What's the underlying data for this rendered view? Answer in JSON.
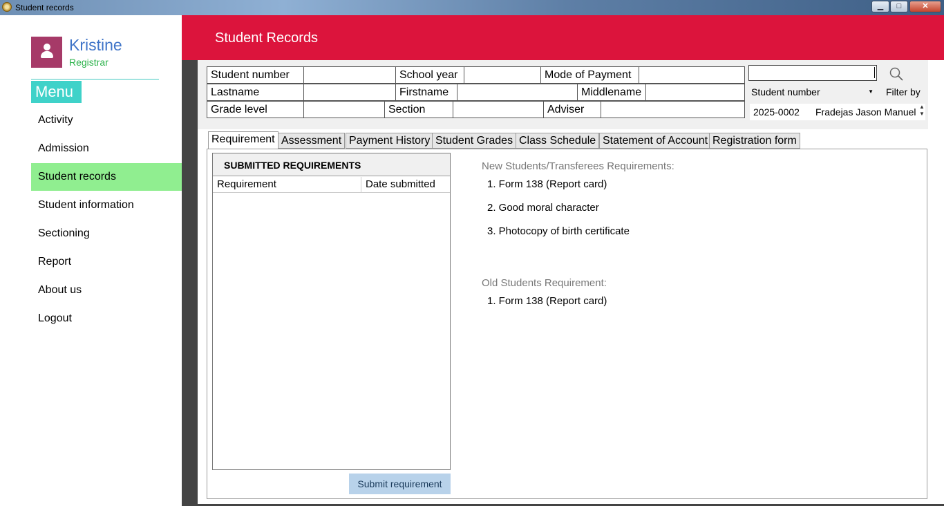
{
  "window": {
    "title": "Student records",
    "min_label": "▭",
    "max_label": "□",
    "close_label": "✕"
  },
  "user": {
    "name": "Kristine",
    "role": "Registrar"
  },
  "menu": {
    "title": "Menu",
    "items": [
      {
        "label": "Activity",
        "active": false
      },
      {
        "label": "Admission",
        "active": false
      },
      {
        "label": "Student records",
        "active": true
      },
      {
        "label": "Student information",
        "active": false
      },
      {
        "label": "Sectioning",
        "active": false
      },
      {
        "label": "Report",
        "active": false
      },
      {
        "label": "About us",
        "active": false
      },
      {
        "label": "Logout",
        "active": false
      }
    ]
  },
  "header": {
    "title": "Student Records"
  },
  "info_grid": {
    "student_number": {
      "label": "Student number",
      "value": ""
    },
    "school_year": {
      "label": "School year",
      "value": ""
    },
    "mode_of_payment": {
      "label": "Mode of Payment",
      "value": ""
    },
    "lastname": {
      "label": "Lastname",
      "value": ""
    },
    "firstname": {
      "label": "Firstname",
      "value": ""
    },
    "middlename": {
      "label": "Middlename",
      "value": ""
    },
    "grade_level": {
      "label": "Grade level",
      "value": ""
    },
    "section": {
      "label": "Section",
      "value": ""
    },
    "adviser": {
      "label": "Adviser",
      "value": ""
    }
  },
  "search": {
    "value": "",
    "filter_selected": "Student number",
    "filter_label": "Filter by",
    "result": {
      "number": "2025-0002",
      "name": "Fradejas Jason Manuel"
    }
  },
  "tabs": [
    {
      "label": "Requirement",
      "active": true
    },
    {
      "label": "Assessment",
      "active": false
    },
    {
      "label": "Payment History",
      "active": false
    },
    {
      "label": "Student Grades",
      "active": false
    },
    {
      "label": "Class Schedule",
      "active": false
    },
    {
      "label": "Statement of Account",
      "active": false
    },
    {
      "label": "Registration form",
      "active": false
    }
  ],
  "submitted": {
    "title": "SUBMITTED REQUIREMENTS",
    "columns": [
      "Requirement",
      "Date submitted"
    ],
    "rows": [],
    "submit_label": "Submit requirement"
  },
  "requirements": {
    "new_heading": "New Students/Transferees Requirements:",
    "new_items": [
      "1. Form 138 (Report card)",
      "2. Good moral character",
      "3. Photocopy of birth certificate"
    ],
    "old_heading": "Old Students Requirement:",
    "old_items": [
      "1. Form 138 (Report card)"
    ]
  },
  "colors": {
    "header": "#dc143c",
    "menu_accent": "#3fd2c9",
    "active_nav": "#90ee90",
    "avatar": "#a63a68"
  },
  "icons": [
    "user-icon",
    "search-icon",
    "chevron-down-icon"
  ]
}
